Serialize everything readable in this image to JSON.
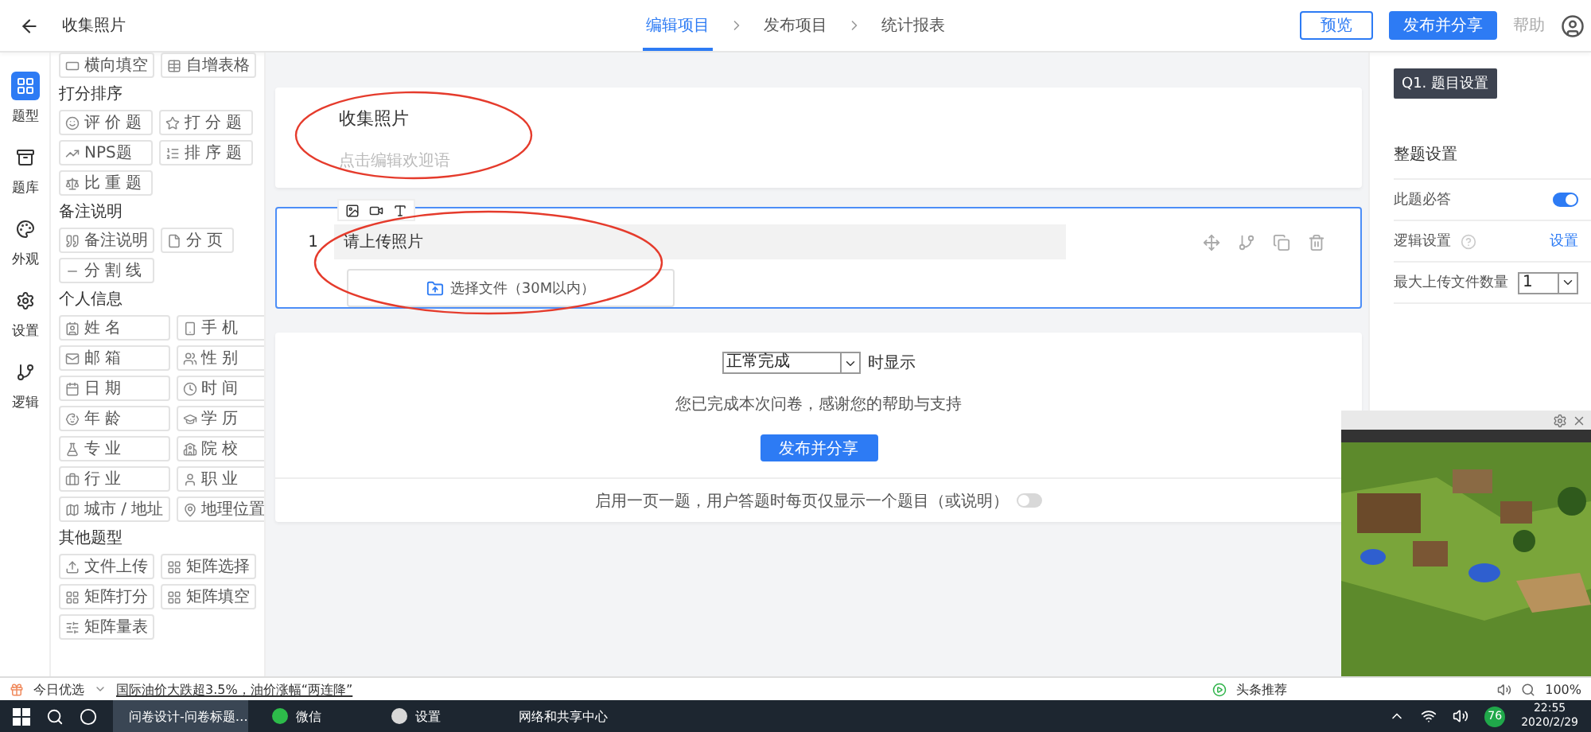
{
  "header": {
    "title": "收集照片",
    "steps": [
      {
        "label": "编辑项目",
        "selected": true
      },
      {
        "label": "发布项目",
        "selected": false
      },
      {
        "label": "统计报表",
        "selected": false
      }
    ],
    "preview": "预览",
    "publish": "发布并分享",
    "help": "帮助"
  },
  "rail": [
    {
      "label": "题型",
      "selected": true
    },
    {
      "label": "题库",
      "selected": false
    },
    {
      "label": "外观",
      "selected": false
    },
    {
      "label": "设置",
      "selected": false
    },
    {
      "label": "逻辑",
      "selected": false
    }
  ],
  "palette": [
    {
      "items": [
        "横向填空",
        "自增表格"
      ]
    },
    {
      "title": "打分排序",
      "items": [
        "评价题",
        "打分题",
        "NPS题",
        "排序题",
        "比重题"
      ]
    },
    {
      "title": "备注说明",
      "items": [
        "备注说明",
        "分页",
        "分割线"
      ]
    },
    {
      "title": "个人信息",
      "items": [
        "姓名",
        "手机",
        "邮箱",
        "性别",
        "日期",
        "时间",
        "年龄",
        "学历",
        "专业",
        "院校",
        "行业",
        "职业",
        "城市 / 地址",
        "地理位置"
      ]
    },
    {
      "title": "其他题型",
      "items": [
        "文件上传",
        "矩阵选择",
        "矩阵打分",
        "矩阵填空",
        "矩阵量表"
      ]
    }
  ],
  "intro": {
    "title": "收集照片",
    "placeholder": "点击编辑欢迎语"
  },
  "question": {
    "number": "1",
    "title": "请上传照片",
    "upload": "选择文件（30M以内）"
  },
  "ending": {
    "condition": "正常完成",
    "condition_suffix": "时显示",
    "message": "您已完成本次问卷，感谢您的帮助与支持",
    "button": "发布并分享"
  },
  "one_per_page": {
    "label": "启用一页一题，用户答题时每页仅显示一个题目（或说明）",
    "on": false
  },
  "settings": {
    "tag": "Q1. 题目设置",
    "heading": "整题设置",
    "rows": [
      {
        "kind": "toggle",
        "label": "此题必答",
        "on": true
      },
      {
        "kind": "link",
        "label": "逻辑设置",
        "link": "设置"
      },
      {
        "kind": "select",
        "label": "最大上传文件数量",
        "value": "1"
      }
    ]
  },
  "status_bar": {
    "promo": "今日优选",
    "news": "国际油价大跌超3.5%，油价涨幅“两连降”",
    "feed": "头条推荐",
    "zoom": "100%"
  },
  "taskbar": {
    "apps": [
      "问卷设计-问卷标题…",
      "微信",
      "设置",
      "网络和共享中心"
    ],
    "badge": "76",
    "time": "22:55",
    "date": "2020/2/29"
  }
}
